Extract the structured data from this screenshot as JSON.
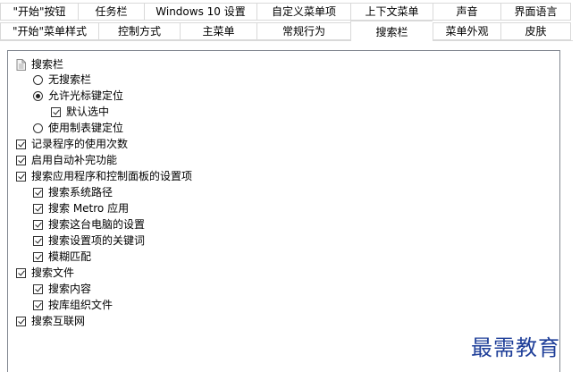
{
  "tabs": {
    "row1": [
      {
        "label": "\"开始\"按钮"
      },
      {
        "label": "任务栏"
      },
      {
        "label": "Windows 10 设置"
      },
      {
        "label": "自定义菜单项"
      },
      {
        "label": "上下文菜单"
      },
      {
        "label": "声音"
      },
      {
        "label": "界面语言"
      }
    ],
    "row2": [
      {
        "label": "\"开始\"菜单样式"
      },
      {
        "label": "控制方式"
      },
      {
        "label": "主菜单"
      },
      {
        "label": "常规行为"
      },
      {
        "label": "搜索栏",
        "selected": true
      },
      {
        "label": "菜单外观"
      },
      {
        "label": "皮肤"
      }
    ]
  },
  "tree": {
    "root": {
      "label": "搜索栏",
      "icon": "document-icon"
    },
    "no_search": {
      "label": "无搜索栏",
      "checked": false
    },
    "allow_cursor": {
      "label": "允许光标键定位",
      "checked": true
    },
    "default_select": {
      "label": "默认选中",
      "checked": true
    },
    "use_tab": {
      "label": "使用制表键定位",
      "checked": false
    },
    "record_usage": {
      "label": "记录程序的使用次数",
      "checked": true
    },
    "autocomplete": {
      "label": "启用自动补完功能",
      "checked": true
    },
    "search_apps": {
      "label": "搜索应用程序和控制面板的设置项",
      "checked": true
    },
    "search_path": {
      "label": "搜索系统路径",
      "checked": true
    },
    "search_metro": {
      "label": "搜索 Metro 应用",
      "checked": true
    },
    "search_pc_settings": {
      "label": "搜索这台电脑的设置",
      "checked": true
    },
    "search_keywords": {
      "label": "搜索设置项的关键词",
      "checked": true
    },
    "fuzzy": {
      "label": "模糊匹配",
      "checked": true
    },
    "search_files": {
      "label": "搜索文件",
      "checked": true
    },
    "search_content": {
      "label": "搜索内容",
      "checked": true
    },
    "library_org": {
      "label": "按库组织文件",
      "checked": true
    },
    "search_internet": {
      "label": "搜索互联网",
      "checked": true
    }
  },
  "watermark": "最需教育"
}
